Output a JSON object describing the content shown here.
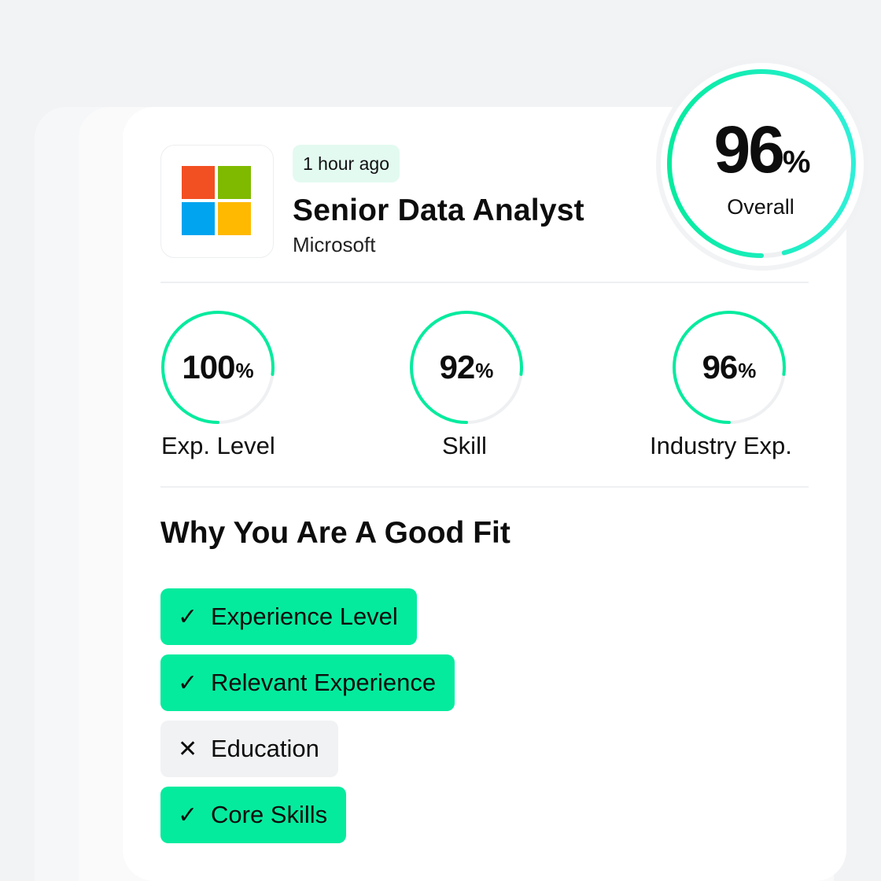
{
  "job": {
    "posted": "1 hour ago",
    "title": "Senior Data Analyst",
    "company": "Microsoft",
    "logo": "microsoft-logo"
  },
  "overall": {
    "value": "96",
    "unit": "%",
    "label": "Overall",
    "progress": 0.96
  },
  "metrics": [
    {
      "value": "100",
      "unit": "%",
      "label": "Exp. Level",
      "progress": 0.77
    },
    {
      "value": "92",
      "unit": "%",
      "label": "Skill",
      "progress": 0.77
    },
    {
      "value": "96",
      "unit": "%",
      "label": "Industry Exp.",
      "progress": 0.77
    }
  ],
  "fit": {
    "title": "Why You Are A Good Fit",
    "items": [
      {
        "mark": "✓",
        "label": "Experience Level",
        "matched": true
      },
      {
        "mark": "✓",
        "label": "Relevant Experience",
        "matched": true
      },
      {
        "mark": "✕",
        "label": "Education",
        "matched": false
      },
      {
        "mark": "✓",
        "label": "Core Skills",
        "matched": true
      }
    ]
  },
  "colors": {
    "accent": "#05eb9e",
    "ring_track": "#eef0f2",
    "badge_bg": "#e3faf1",
    "overall_gradient_start": "#2ef0d8",
    "overall_gradient_end": "#05eb9e",
    "unmatched_bg": "#f1f2f4",
    "ms_red": "#f25022",
    "ms_green": "#7fba00",
    "ms_blue": "#00a4ef",
    "ms_yellow": "#ffb900"
  }
}
